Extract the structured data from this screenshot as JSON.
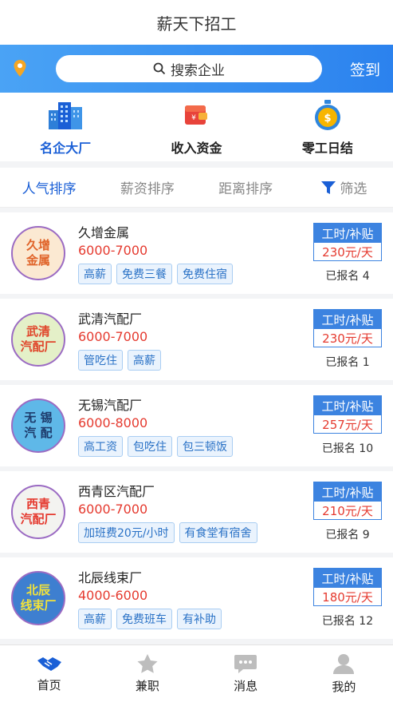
{
  "header": {
    "title": "薪天下招工"
  },
  "search": {
    "placeholder": "搜索企业",
    "signin": "签到"
  },
  "categories": [
    {
      "label": "名企大厂",
      "icon": "buildings-icon"
    },
    {
      "label": "收入资金",
      "icon": "wallet-icon"
    },
    {
      "label": "零工日结",
      "icon": "coin-stopwatch-icon"
    }
  ],
  "sort": {
    "popular": "人气排序",
    "salary": "薪资排序",
    "distance": "距离排序",
    "filter": "筛选"
  },
  "jobs": [
    {
      "logo": "久增\n金属",
      "company": "久增金属",
      "salary": "6000-7000",
      "tags": [
        "高薪",
        "免费三餐",
        "免费住宿"
      ],
      "badge": "工时/补贴",
      "rate": "230元/天",
      "enrolled": "已报名 4",
      "logo_color": "#e0642a",
      "logo_bg": "#fbe9d2"
    },
    {
      "logo": "武清\n汽配厂",
      "company": "武清汽配厂",
      "salary": "6000-7000",
      "tags": [
        "管吃住",
        "高薪"
      ],
      "badge": "工时/补贴",
      "rate": "230元/天",
      "enrolled": "已报名 1",
      "logo_color": "#e0452a",
      "logo_bg": "#e4f0c8"
    },
    {
      "logo": "无 锡\n汽 配",
      "company": "无锡汽配厂",
      "salary": "6000-8000",
      "tags": [
        "高工资",
        "包吃住",
        "包三顿饭"
      ],
      "badge": "工时/补贴",
      "rate": "257元/天",
      "enrolled": "已报名 10",
      "logo_color": "#1d3a6b",
      "logo_bg": "#5fb8e8"
    },
    {
      "logo": "西青\n汽配厂",
      "company": "西青区汽配厂",
      "salary": "6000-7000",
      "tags": [
        "加班费20元/小时",
        "有食堂有宿舍"
      ],
      "badge": "工时/补贴",
      "rate": "210元/天",
      "enrolled": "已报名 9",
      "logo_color": "#e53a2f",
      "logo_bg": "#f3f3f0"
    },
    {
      "logo": "北辰\n线束厂",
      "company": "北辰线束厂",
      "salary": "4000-6000",
      "tags": [
        "高薪",
        "免费班车",
        "有补助"
      ],
      "badge": "工时/补贴",
      "rate": "180元/天",
      "enrolled": "已报名 12",
      "logo_color": "#f2e23a",
      "logo_bg": "#3e7fd0"
    }
  ],
  "tabbar": [
    {
      "label": "首页",
      "icon": "handshake-icon"
    },
    {
      "label": "兼职",
      "icon": "star-icon"
    },
    {
      "label": "消息",
      "icon": "chat-icon"
    },
    {
      "label": "我的",
      "icon": "user-icon"
    }
  ]
}
